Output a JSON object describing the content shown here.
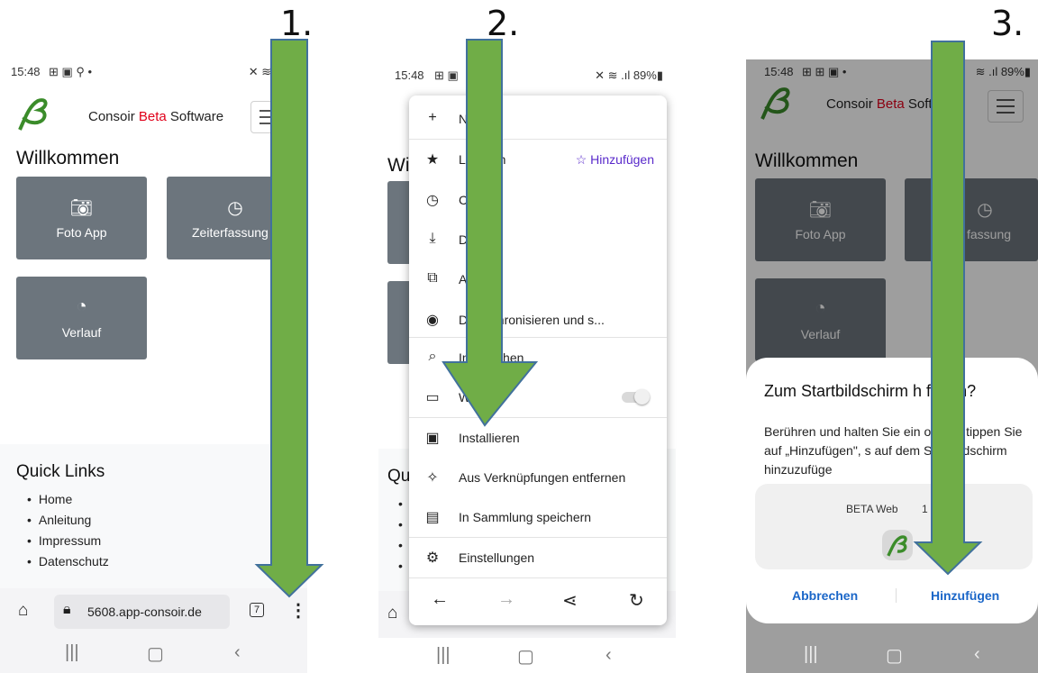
{
  "steps": [
    "1.",
    "2.",
    "3."
  ],
  "status": {
    "time": "15:48",
    "icons_left_1": "⊞ ▣ ⚲ •",
    "icons_right_1": "✕ ≋ .ıl 89",
    "icons_left_2": "⊞ ▣",
    "icons_right_2": "✕ ≋ .ıl 89%▮",
    "icons_left_3": "⊞ ⊞ ▣ •",
    "icons_right_3": "≋ .ıl 89%▮"
  },
  "app": {
    "brand_prefix": "Consoir ",
    "brand_red": "Beta",
    "brand_suffix": " Software",
    "brand_suffix_cut": " Soft",
    "welcome": "Willkommen",
    "welcome_cut": "Wi",
    "tiles": {
      "foto": "Foto App",
      "zeit": "Zeiterfassung",
      "zeit_cut": "fassung",
      "verlauf": "Verlauf"
    },
    "quick_links_title": "Quick Links",
    "quick_links_title_cut": "Qu",
    "quick_links": [
      "Home",
      "Anleitung",
      "Impressum",
      "Datenschutz"
    ]
  },
  "browser": {
    "url": "5608.app-consoir.de",
    "tab_count": "7"
  },
  "menu": {
    "items": [
      {
        "label": "N     Tab"
      },
      {
        "label": "L      eichen",
        "extra": "Hinzufügen"
      },
      {
        "label": "C     k"
      },
      {
        "label": "D     oads"
      },
      {
        "label": "A     ns"
      },
      {
        "label": "D     synchronisieren und s..."
      },
      {
        "label": "In     e suchen"
      },
      {
        "label": "                Website"
      },
      {
        "label": "Installieren"
      },
      {
        "label": "Aus Verknüpfungen entfernen"
      },
      {
        "label": "In Sammlung speichern"
      },
      {
        "label": "Einstellungen"
      }
    ]
  },
  "dialog": {
    "title": "Zum Startbildschirm h      fügen?",
    "text": "Berühren und halten Sie ein        ol oder tippen Sie auf „Hinzufügen\",      s auf dem Startbildschirm hinzuzufüge",
    "widget_name": "BETA Web",
    "widget_num": "1",
    "cancel": "Abbrechen",
    "confirm": "Hinzufügen"
  },
  "colors": {
    "arrow_fill": "#70ad47",
    "arrow_stroke": "#41719c",
    "tile": "#6c757d",
    "brand_red": "#e0001a",
    "purple": "#592acb",
    "blue": "#1a66c8"
  }
}
